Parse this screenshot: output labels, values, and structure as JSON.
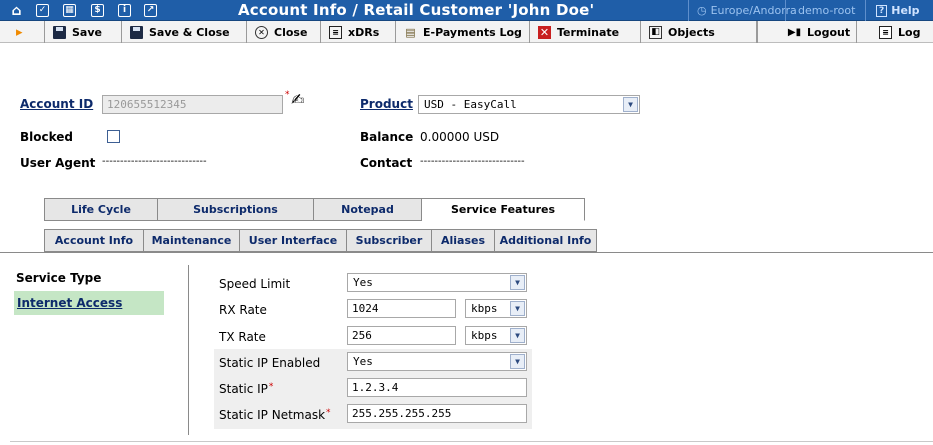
{
  "header": {
    "title": "Account Info / Retail Customer 'John Doe'",
    "timezone": "Europe/Andorra",
    "user": "demo-root",
    "help": "Help",
    "icons": [
      {
        "name": "home-icon",
        "glyph": "⌂"
      },
      {
        "name": "check-icon",
        "glyph": "✓"
      },
      {
        "name": "grid-icon",
        "glyph": "▦"
      },
      {
        "name": "dollar-icon",
        "glyph": "$"
      },
      {
        "name": "info-icon",
        "glyph": "i"
      },
      {
        "name": "chart-icon",
        "glyph": "↗"
      }
    ]
  },
  "toolbar": {
    "play": "▸",
    "save": "Save",
    "save_close": "Save & Close",
    "close": "Close",
    "xdrs": "xDRs",
    "epayments": "E-Payments Log",
    "terminate": "Terminate",
    "objects": "Objects",
    "logout": "Logout",
    "log": "Log"
  },
  "account": {
    "id_label": "Account ID",
    "id_value": "120655512345",
    "blocked_label": "Blocked",
    "useragent_label": "User Agent",
    "useragent_value": "-----------------------------",
    "product_label": "Product",
    "product_value": "USD - EasyCall",
    "balance_label": "Balance",
    "balance_value": "0.00000 USD",
    "contact_label": "Contact",
    "contact_value": "-----------------------------"
  },
  "tabs_top": [
    "Life Cycle",
    "Subscriptions",
    "Notepad",
    "Service Features"
  ],
  "tabs_bottom": [
    "Account Info",
    "Maintenance",
    "User Interface",
    "Subscriber",
    "Aliases",
    "Additional Info"
  ],
  "sidebar": {
    "heading": "Service Type",
    "item": "Internet Access"
  },
  "features": {
    "speed_limit_label": "Speed Limit",
    "speed_limit_value": "Yes",
    "rx_label": "RX Rate",
    "rx_value": "1024",
    "rx_unit": "kbps",
    "tx_label": "TX Rate",
    "tx_value": "256",
    "tx_unit": "kbps",
    "static_enabled_label": "Static IP Enabled",
    "static_enabled_value": "Yes",
    "static_ip_label": "Static IP",
    "static_ip_value": "1.2.3.4",
    "netmask_label": "Static IP Netmask",
    "netmask_value": "255.255.255.255"
  },
  "colors": {
    "header_bg": "#1f5ea8",
    "sidebar_active": "#c5e6c5",
    "highlight_bg": "#efefef",
    "required": "#cc0000"
  }
}
